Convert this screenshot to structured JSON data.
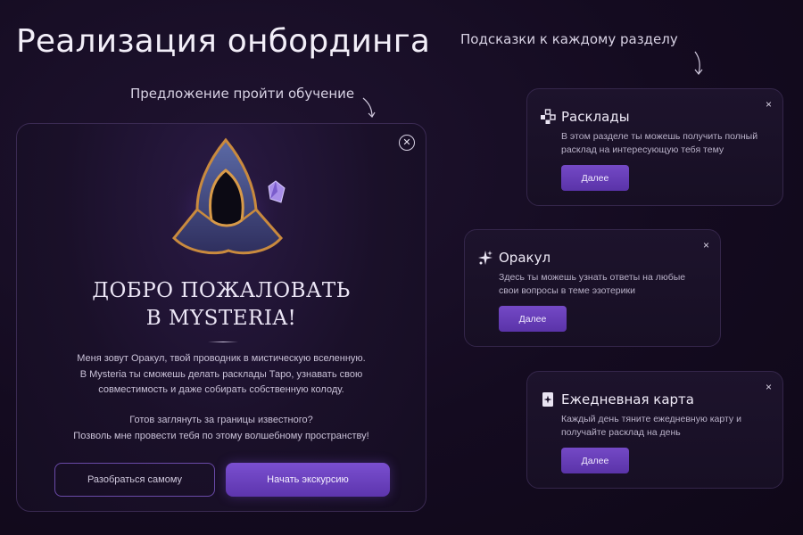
{
  "page_title": "Реализация онбординга",
  "captions": {
    "tips": "Подсказки к каждому разделу",
    "offer": "Предложение пройти обучение"
  },
  "modal": {
    "close_icon": "close-circle-icon",
    "mascot_icon": "hooded-oracle-icon",
    "heading_line1": "ДОБРО ПОЖАЛОВАТЬ",
    "heading_line2": "В MYSTERIA!",
    "body_lines": [
      "Меня зовут Оракул, твой проводник в мистическую вселенную.",
      "В Mysteria ты сможешь делать расклады Таро, узнавать свою",
      "совместимость и даже собирать собственную колоду."
    ],
    "question_lines": [
      "Готов заглянуть за границы известного?",
      "Позволь мне провести тебя по этому волшебному пространству!"
    ],
    "secondary_button": "Разобраться самому",
    "primary_button": "Начать экскурсию"
  },
  "tips": [
    {
      "icon": "spreads-icon",
      "title": "Расклады",
      "text": "В этом разделе ты можешь получить полный расклад на интересующую тебя тему",
      "button": "Далее",
      "close": "×"
    },
    {
      "icon": "oracle-sparkle-icon",
      "title": "Оракул",
      "text": "Здесь ты можешь узнать ответы на любые свои вопросы в теме эзотерики",
      "button": "Далее",
      "close": "×"
    },
    {
      "icon": "daily-card-icon",
      "title": "Ежедневная карта",
      "text": "Каждый день тяните ежедневную карту и получайте расклад на день",
      "button": "Далее",
      "close": "×"
    }
  ],
  "colors": {
    "background": "#140b20",
    "accent": "#6a3fc0",
    "card_border": "#34264a"
  }
}
